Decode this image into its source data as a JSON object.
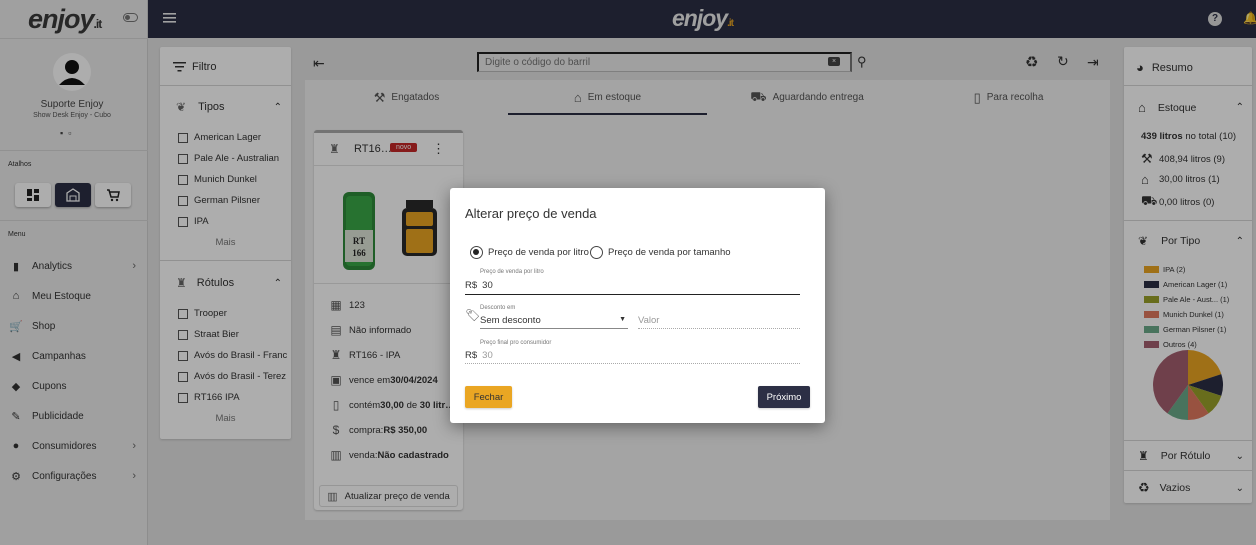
{
  "brand": {
    "logo_main": "enjoy",
    "logo_suffix": ".it"
  },
  "user": {
    "name": "Suporte Enjoy",
    "subtitle": "Show Desk Enjoy - Cubo"
  },
  "sidebar": {
    "shortcuts_label": "Atalhos",
    "menu_label": "Menu",
    "items": [
      {
        "label": "Analytics",
        "icon": "bar-chart-icon",
        "has_submenu": true
      },
      {
        "label": "Meu Estoque",
        "icon": "warehouse-icon",
        "has_submenu": false
      },
      {
        "label": "Shop",
        "icon": "cart-icon",
        "has_submenu": false
      },
      {
        "label": "Campanhas",
        "icon": "megaphone-icon",
        "has_submenu": false
      },
      {
        "label": "Cupons",
        "icon": "tag-icon",
        "has_submenu": false
      },
      {
        "label": "Publicidade",
        "icon": "ad-icon",
        "has_submenu": false
      },
      {
        "label": "Consumidores",
        "icon": "person-icon",
        "has_submenu": true
      },
      {
        "label": "Configurações",
        "icon": "gear-icon",
        "has_submenu": true
      }
    ]
  },
  "filter": {
    "title": "Filtro",
    "tipos_title": "Tipos",
    "tipos": [
      "American Lager",
      "Pale Ale - Australian",
      "Munich Dunkel",
      "German Pilsner",
      "IPA"
    ],
    "rotulos_title": "Rótulos",
    "rotulos": [
      "Trooper",
      "Straat Bier",
      "Avós do Brasil - Franc",
      "Avós do Brasil - Terez",
      "RT166 IPA"
    ],
    "more_label": "Mais"
  },
  "search": {
    "placeholder": "Digite o código do barril"
  },
  "tabs": [
    "Engatados",
    "Em estoque",
    "Aguardando entrega",
    "Para recolha"
  ],
  "active_tab": "Em estoque",
  "product": {
    "name": "RT16…",
    "badge": "novo",
    "code": "123",
    "info": "Não informado",
    "label": "RT166 - IPA",
    "expires_prefix": "vence em ",
    "expires": "30/04/2024",
    "contains_prefix": "contém ",
    "contains_amount": "30,00",
    "contains_mid": " de ",
    "contains_total": "30 litr…",
    "purchase_prefix": "compra: ",
    "purchase": "R$ 350,00",
    "sale_prefix": "venda: ",
    "sale": "Não cadastrado",
    "update_button": "Atualizar preço de venda"
  },
  "summary": {
    "title": "Resumo",
    "estoque_title": "Estoque",
    "total_amount": "439 litros",
    "total_suffix": " no total (10)",
    "rows": [
      {
        "icon": "tap-icon",
        "text": "408,94 litros (9)"
      },
      {
        "icon": "warehouse-icon",
        "text": "30,00 litros (1)"
      },
      {
        "icon": "truck-icon",
        "text": "0,00 litros (0)"
      }
    ],
    "por_tipo_title": "Por Tipo",
    "legend": [
      {
        "label": "IPA (2)",
        "color": "#eaa623",
        "value": 2
      },
      {
        "label": "American Lager (1)",
        "color": "#2c2f45",
        "value": 1
      },
      {
        "label": "Pale Ale - Aust... (1)",
        "color": "#9aa12a",
        "value": 1
      },
      {
        "label": "Munich Dunkel (1)",
        "color": "#e07a5f",
        "value": 1
      },
      {
        "label": "German Pilsner (1)",
        "color": "#6aaa8a",
        "value": 1
      },
      {
        "label": "Outros (4)",
        "color": "#a45f6f",
        "value": 4
      }
    ],
    "por_rotulo_title": "Por Rótulo",
    "vazios_title": "Vazios"
  },
  "modal": {
    "title": "Alterar preço de venda",
    "option_liter": "Preço de venda por litro",
    "option_size": "Preço de venda por tamanho",
    "selected_option": "liter",
    "price_label": "Preço de venda por litro",
    "currency": "R$",
    "price_value": "30",
    "discount_label": "Desconto em",
    "discount_value": "Sem desconto",
    "discount_placeholder": "Valor",
    "final_label": "Preço final pro consumidor",
    "final_value": "30",
    "close_button": "Fechar",
    "next_button": "Próximo"
  }
}
